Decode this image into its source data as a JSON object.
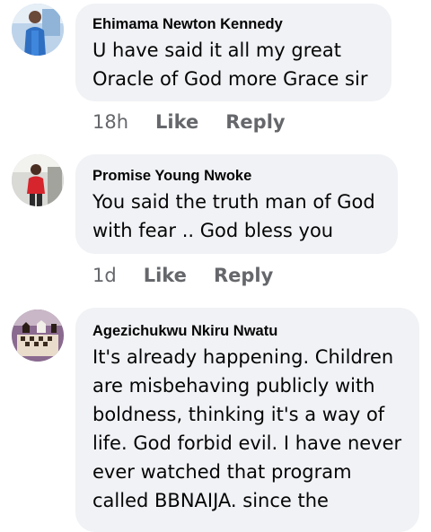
{
  "comments": [
    {
      "author": "Ehimama Newton Kennedy",
      "text": "U have said it all my great Oracle of God more Grace sir",
      "time": "18h",
      "like_label": "Like",
      "reply_label": "Reply"
    },
    {
      "author": "Promise Young Nwoke",
      "text": "You said the truth man of God with fear .. God bless you",
      "time": "1d",
      "like_label": "Like",
      "reply_label": "Reply"
    },
    {
      "author": "Agezichukwu Nkiru Nwatu",
      "text": "It's already happening. Children are misbehaving publicly with boldness, thinking it's a way of life. God forbid evil. I have never ever watched that program called BBNAIJA.  since the"
    }
  ],
  "colors": {
    "bubble_bg": "#f0f2f5",
    "meta_text": "#65676b",
    "text": "#050505"
  }
}
